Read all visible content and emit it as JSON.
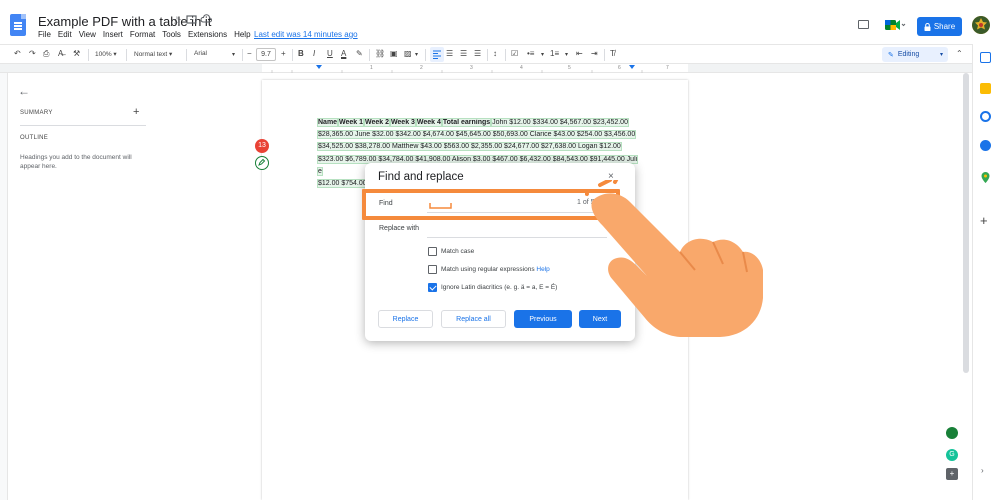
{
  "header": {
    "title": "Example PDF with a table in it",
    "menu": [
      "File",
      "Edit",
      "View",
      "Insert",
      "Format",
      "Tools",
      "Extensions",
      "Help"
    ],
    "last_edit": "Last edit was 14 minutes ago",
    "share_label": "Share"
  },
  "toolbar": {
    "zoom": "100%",
    "style": "Normal text",
    "font": "Arial",
    "font_size": "9.7",
    "bold": "B",
    "italic": "I",
    "underline": "U",
    "text_color": "A",
    "mode": "Editing"
  },
  "ruler": {
    "ticks": [
      "1",
      "2",
      "3",
      "4",
      "5",
      "6",
      "7"
    ]
  },
  "left_panel": {
    "summary_label": "SUMMARY",
    "summary_add": "+",
    "outline_label": "OUTLINE",
    "outline_hint": "Headings you add to the document will appear here."
  },
  "document": {
    "headers": [
      "Name",
      "Week 1",
      "Week 2",
      "Week 3",
      "Week 4",
      "Total earnings"
    ],
    "line1": "John $12.00 $334.00 $4,567.00 $23,452.00",
    "line2": "$28,365.00 June $32.00 $342.00 $4,674.00 $45,645.00 $50,693.00 Clarice $43.00 $254.00 $3,456.00",
    "line3": "$34,525.00 $38,278.00 Matthew $43.00 $563.00 $2,355.00 $24,677.00 $27,638.00 Logan $12.00",
    "line4": "$323.00 $6,789.00 $34,784.00 $41,908.00 Alison $3.00 $467.00 $6,432.00 $84,543.00 $91,445.00 Julie",
    "line5": "$12.00 $754.00"
  },
  "comments": {
    "count": "13"
  },
  "dialog": {
    "title": "Find and replace",
    "close": "×",
    "find_label": "Find",
    "find_counter": "1 of 52",
    "replace_label": "Replace with",
    "match_case": "Match case",
    "regex": "Match using regular expressions",
    "regex_help": "Help",
    "diacritics": "Ignore Latin diacritics (e. g. ä = a, E = É)",
    "replace_btn": "Replace",
    "replace_all_btn": "Replace all",
    "previous_btn": "Previous",
    "next_btn": "Next"
  },
  "colors": {
    "accent": "#1a73e8",
    "highlight": "#f58a3c",
    "hand": "#f9a86b"
  }
}
